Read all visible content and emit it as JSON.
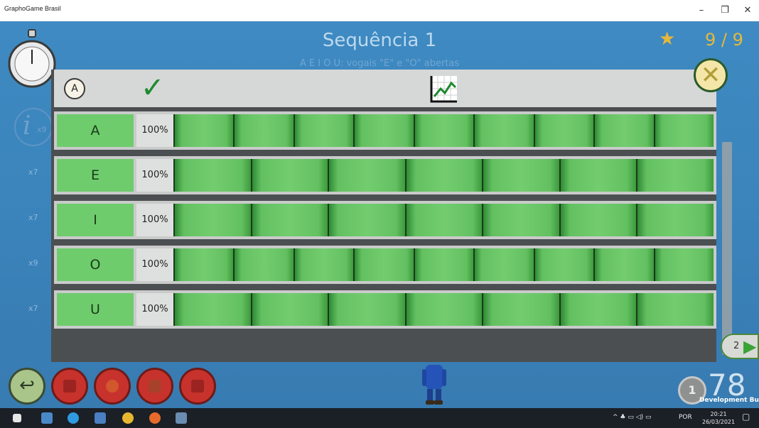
{
  "window": {
    "title": "GraphoGame Brasil",
    "minimize": "–",
    "restore": "❐",
    "close": "✕"
  },
  "header": {
    "title": "Sequência 1",
    "subtitle": "A E I O U: vogais \"E\" e \"O\" abertas",
    "score": "9 / 9"
  },
  "sidebar": {
    "info_count": "x9",
    "multipliers": [
      "x7",
      "x7",
      "x9",
      "x7"
    ]
  },
  "panel": {
    "badge_letter": "A",
    "rows": [
      {
        "letter": "A",
        "percent": "100%",
        "segments": 9
      },
      {
        "letter": "E",
        "percent": "100%",
        "segments": 7
      },
      {
        "letter": "I",
        "percent": "100%",
        "segments": 7
      },
      {
        "letter": "O",
        "percent": "100%",
        "segments": 9
      },
      {
        "letter": "U",
        "percent": "100%",
        "segments": 7
      }
    ]
  },
  "nav": {
    "page_label": "2",
    "coin_value": "1",
    "points": "78",
    "dev_build": "Development Build"
  },
  "taskbar": {
    "language": "POR",
    "time": "20:21",
    "date": "26/03/2021"
  },
  "colors": {
    "accent_green": "#6ecc6c",
    "background_blue": "#3b84bc",
    "star_gold": "#e7b73b"
  }
}
